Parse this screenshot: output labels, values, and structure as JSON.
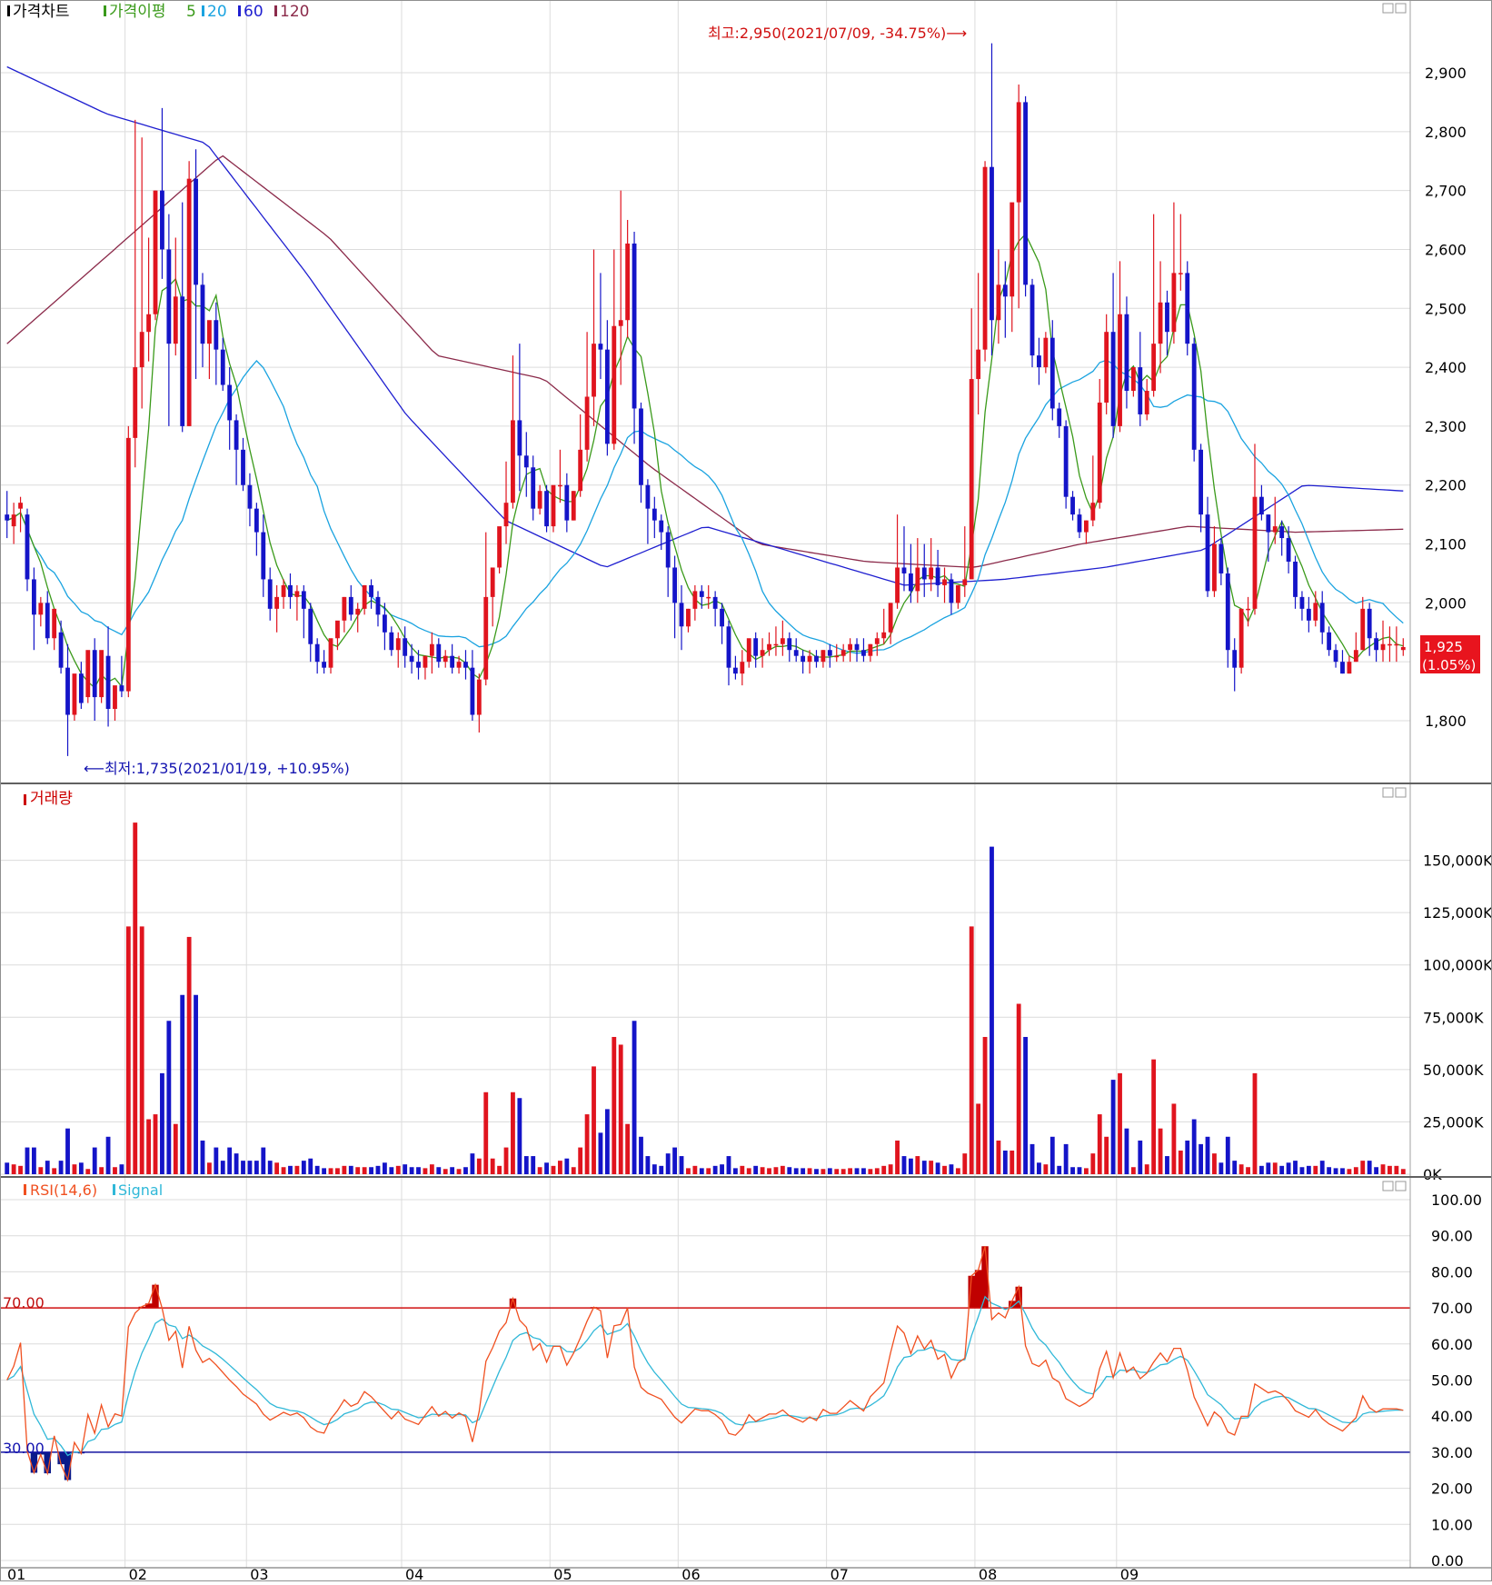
{
  "price_panel": {
    "legend": [
      {
        "label": "가격차트",
        "color": "#000000"
      },
      {
        "label": "가격이평",
        "color": "#3a9a1a"
      },
      {
        "label": "5",
        "color": "#3a9a1a"
      },
      {
        "label": "20",
        "color": "#1aa3e0"
      },
      {
        "label": "60",
        "color": "#1f1fd0"
      },
      {
        "label": "120",
        "color": "#8b2a4a"
      }
    ],
    "high_annotation": "최고:2,950(2021/07/09, -34.75%)⟶",
    "low_annotation": "⟵최저:1,735(2021/01/19, +10.95%)",
    "y_ticks": [
      "2,900",
      "2,800",
      "2,700",
      "2,600",
      "2,500",
      "2,400",
      "2,300",
      "2,200",
      "2,100",
      "2,000",
      "1,800"
    ],
    "current_price": "1,925",
    "current_change": "(1.05%)"
  },
  "volume_panel": {
    "legend": [
      {
        "label": "거래량",
        "color": "#cc0000"
      }
    ],
    "y_ticks": [
      "150,000K",
      "125,000K",
      "100,000K",
      "75,000K",
      "50,000K",
      "25,000K",
      "0K"
    ]
  },
  "rsi_panel": {
    "legend": [
      {
        "label": "RSI(14,6)",
        "color": "#f05020"
      },
      {
        "label": "Signal",
        "color": "#30b8d8"
      }
    ],
    "y_ticks": [
      "100.00",
      "90.00",
      "80.00",
      "70.00",
      "60.00",
      "50.00",
      "40.00",
      "30.00",
      "20.00",
      "10.00",
      "0.00"
    ],
    "upper_line_label": "70.00",
    "lower_line_label": "30.00"
  },
  "x_labels": [
    "01",
    "02",
    "03",
    "04",
    "05",
    "06",
    "07",
    "08",
    "09"
  ],
  "colors": {
    "up": "#e0141e",
    "down": "#1414c8",
    "ma5": "#3a9a1a",
    "ma20": "#1aa3e0",
    "ma60": "#1f1fd0",
    "ma120": "#8b2a4a",
    "rsi": "#f05020",
    "signal": "#30b8d8",
    "grid": "#dcdcdc"
  },
  "chart_data": {
    "type": "candlestick",
    "ylim": [
      1700,
      2990
    ],
    "volume_ylim": [
      0,
      175000
    ],
    "rsi_ylim": [
      0,
      100
    ],
    "months": [
      "01",
      "02",
      "03",
      "04",
      "05",
      "06",
      "07",
      "08",
      "09"
    ],
    "high": {
      "value": 2950,
      "date": "2021/07/09",
      "change": "-34.75%"
    },
    "low": {
      "value": 1735,
      "date": "2021/01/19",
      "change": "+10.95%"
    },
    "last_close": 1925,
    "last_change_pct": 1.05,
    "rsi_levels": [
      70,
      30
    ],
    "months_candles": [
      {
        "month": "01",
        "days": 18
      },
      {
        "month": "02",
        "days": 18
      },
      {
        "month": "03",
        "days": 23
      },
      {
        "month": "04",
        "days": 22
      },
      {
        "month": "05",
        "days": 19
      },
      {
        "month": "06",
        "days": 22
      },
      {
        "month": "07",
        "days": 22
      },
      {
        "month": "08",
        "days": 21
      },
      {
        "month": "09",
        "days": 16
      }
    ],
    "candles": [
      [
        2150,
        2190,
        2140,
        2110
      ],
      [
        2130,
        2170,
        2150,
        2100
      ],
      [
        2160,
        2180,
        2170,
        2120
      ],
      [
        2150,
        2160,
        2040,
        2020
      ],
      [
        2040,
        2060,
        1980,
        1920
      ],
      [
        1980,
        2010,
        2000,
        1960
      ],
      [
        2000,
        2020,
        1940,
        1930
      ],
      [
        1940,
        1960,
        1990,
        1920
      ],
      [
        1950,
        1970,
        1890,
        1880
      ],
      [
        1890,
        1930,
        1810,
        1740
      ],
      [
        1810,
        1870,
        1880,
        1800
      ],
      [
        1880,
        1900,
        1830,
        1820
      ],
      [
        1840,
        1860,
        1920,
        1830
      ],
      [
        1920,
        1940,
        1840,
        1800
      ],
      [
        1840,
        1880,
        1920,
        1830
      ],
      [
        1910,
        1960,
        1820,
        1790
      ],
      [
        1820,
        1850,
        1860,
        1800
      ],
      [
        1860,
        1910,
        1850,
        1840
      ],
      [
        1850,
        2300,
        2280,
        1840
      ],
      [
        2280,
        2820,
        2400,
        2230
      ],
      [
        2400,
        2790,
        2460,
        2330
      ],
      [
        2460,
        2620,
        2490,
        2410
      ],
      [
        2490,
        2700,
        2700,
        2480
      ],
      [
        2700,
        2840,
        2600,
        2550
      ],
      [
        2600,
        2660,
        2440,
        2300
      ],
      [
        2440,
        2620,
        2520,
        2420
      ],
      [
        2520,
        2680,
        2300,
        2290
      ],
      [
        2300,
        2750,
        2720,
        2300
      ],
      [
        2720,
        2770,
        2540,
        2380
      ],
      [
        2540,
        2560,
        2440,
        2400
      ],
      [
        2440,
        2460,
        2480,
        2380
      ],
      [
        2480,
        2510,
        2430,
        2370
      ],
      [
        2430,
        2450,
        2370,
        2360
      ],
      [
        2370,
        2400,
        2310,
        2260
      ],
      [
        2310,
        2320,
        2260,
        2200
      ],
      [
        2260,
        2280,
        2200,
        2190
      ],
      [
        2200,
        2220,
        2160,
        2130
      ],
      [
        2160,
        2170,
        2120,
        2080
      ],
      [
        2120,
        2150,
        2040,
        2010
      ],
      [
        2040,
        2060,
        1990,
        1970
      ],
      [
        1990,
        2030,
        2010,
        1950
      ],
      [
        2010,
        2040,
        2030,
        1990
      ],
      [
        2030,
        2050,
        2010,
        1990
      ],
      [
        2010,
        2030,
        2020,
        1970
      ],
      [
        2020,
        2030,
        1990,
        1940
      ],
      [
        1990,
        2000,
        1930,
        1900
      ],
      [
        1930,
        1940,
        1900,
        1880
      ],
      [
        1900,
        1920,
        1890,
        1880
      ],
      [
        1890,
        1920,
        1940,
        1880
      ],
      [
        1940,
        1960,
        1970,
        1920
      ],
      [
        1970,
        2010,
        2010,
        1950
      ],
      [
        2010,
        2030,
        1980,
        1970
      ],
      [
        1980,
        2000,
        1990,
        1950
      ],
      [
        1990,
        2030,
        2030,
        1980
      ],
      [
        2030,
        2040,
        2010,
        1990
      ],
      [
        2010,
        2020,
        1980,
        1960
      ],
      [
        1980,
        2000,
        1950,
        1920
      ],
      [
        1950,
        1960,
        1920,
        1910
      ],
      [
        1920,
        1950,
        1940,
        1890
      ],
      [
        1940,
        1960,
        1910,
        1890
      ],
      [
        1910,
        1930,
        1900,
        1880
      ],
      [
        1900,
        1920,
        1890,
        1870
      ],
      [
        1890,
        1910,
        1910,
        1870
      ],
      [
        1910,
        1950,
        1930,
        1880
      ],
      [
        1930,
        1940,
        1900,
        1890
      ],
      [
        1900,
        1920,
        1910,
        1890
      ],
      [
        1910,
        1930,
        1890,
        1880
      ],
      [
        1890,
        1910,
        1900,
        1880
      ],
      [
        1900,
        1920,
        1890,
        1870
      ],
      [
        1890,
        1920,
        1810,
        1800
      ],
      [
        1810,
        1880,
        1870,
        1780
      ],
      [
        1870,
        2120,
        2010,
        1860
      ],
      [
        2010,
        2060,
        2060,
        1960
      ],
      [
        2060,
        2110,
        2130,
        2050
      ],
      [
        2130,
        2240,
        2170,
        2100
      ],
      [
        2170,
        2420,
        2310,
        2160
      ],
      [
        2310,
        2440,
        2250,
        2190
      ],
      [
        2250,
        2290,
        2230,
        2180
      ],
      [
        2230,
        2250,
        2160,
        2140
      ],
      [
        2160,
        2200,
        2190,
        2150
      ],
      [
        2190,
        2200,
        2130,
        2120
      ],
      [
        2130,
        2180,
        2200,
        2120
      ],
      [
        2200,
        2260,
        2200,
        2170
      ],
      [
        2200,
        2220,
        2140,
        2120
      ],
      [
        2140,
        2190,
        2190,
        2140
      ],
      [
        2190,
        2320,
        2260,
        2180
      ],
      [
        2260,
        2460,
        2350,
        2240
      ],
      [
        2350,
        2600,
        2440,
        2300
      ],
      [
        2440,
        2560,
        2430,
        2380
      ],
      [
        2430,
        2480,
        2270,
        2250
      ],
      [
        2270,
        2600,
        2470,
        2260
      ],
      [
        2470,
        2700,
        2480,
        2370
      ],
      [
        2480,
        2650,
        2610,
        2450
      ],
      [
        2610,
        2630,
        2330,
        2270
      ],
      [
        2330,
        2340,
        2200,
        2170
      ],
      [
        2200,
        2210,
        2160,
        2100
      ],
      [
        2160,
        2180,
        2140,
        2110
      ],
      [
        2140,
        2150,
        2120,
        2090
      ],
      [
        2120,
        2130,
        2060,
        2010
      ],
      [
        2060,
        2080,
        2000,
        1940
      ],
      [
        2000,
        2030,
        1960,
        1920
      ],
      [
        1960,
        1990,
        1990,
        1950
      ],
      [
        1990,
        2030,
        2020,
        1970
      ],
      [
        2020,
        2030,
        2010,
        1990
      ],
      [
        2010,
        2030,
        2010,
        1990
      ],
      [
        2010,
        2020,
        1990,
        1960
      ],
      [
        1990,
        2000,
        1960,
        1930
      ],
      [
        1960,
        1970,
        1890,
        1860
      ],
      [
        1890,
        1910,
        1880,
        1870
      ],
      [
        1880,
        1920,
        1900,
        1860
      ],
      [
        1900,
        1930,
        1940,
        1890
      ],
      [
        1940,
        1950,
        1910,
        1890
      ],
      [
        1910,
        1940,
        1920,
        1890
      ],
      [
        1920,
        1950,
        1930,
        1910
      ],
      [
        1930,
        1960,
        1930,
        1910
      ],
      [
        1930,
        1970,
        1940,
        1910
      ],
      [
        1940,
        1950,
        1920,
        1900
      ],
      [
        1920,
        1940,
        1910,
        1900
      ],
      [
        1910,
        1920,
        1900,
        1880
      ],
      [
        1900,
        1920,
        1910,
        1880
      ],
      [
        1910,
        1920,
        1900,
        1890
      ],
      [
        1900,
        1920,
        1920,
        1890
      ],
      [
        1920,
        1930,
        1910,
        1890
      ],
      [
        1910,
        1930,
        1910,
        1900
      ],
      [
        1910,
        1930,
        1920,
        1900
      ],
      [
        1920,
        1940,
        1930,
        1900
      ],
      [
        1930,
        1940,
        1920,
        1900
      ],
      [
        1920,
        1940,
        1910,
        1900
      ],
      [
        1910,
        1930,
        1930,
        1900
      ],
      [
        1930,
        1950,
        1940,
        1910
      ],
      [
        1940,
        1990,
        1950,
        1930
      ],
      [
        1950,
        2000,
        2000,
        1930
      ],
      [
        2000,
        2150,
        2060,
        1990
      ],
      [
        2060,
        2130,
        2050,
        2020
      ],
      [
        2050,
        2100,
        2020,
        2000
      ],
      [
        2020,
        2110,
        2060,
        2000
      ],
      [
        2060,
        2100,
        2040,
        2010
      ],
      [
        2040,
        2110,
        2060,
        2020
      ],
      [
        2060,
        2090,
        2030,
        2010
      ],
      [
        2030,
        2060,
        2040,
        2000
      ],
      [
        2040,
        2050,
        2000,
        1980
      ],
      [
        2000,
        2030,
        2030,
        1990
      ],
      [
        2030,
        2130,
        2040,
        2010
      ],
      [
        2040,
        2500,
        2380,
        2040
      ],
      [
        2380,
        2560,
        2430,
        2320
      ],
      [
        2430,
        2750,
        2740,
        2410
      ],
      [
        2740,
        2950,
        2480,
        2420
      ],
      [
        2480,
        2600,
        2540,
        2440
      ],
      [
        2540,
        2580,
        2520,
        2450
      ],
      [
        2520,
        2590,
        2680,
        2460
      ],
      [
        2680,
        2880,
        2850,
        2500
      ],
      [
        2850,
        2860,
        2540,
        2520
      ],
      [
        2540,
        2550,
        2420,
        2400
      ],
      [
        2420,
        2450,
        2400,
        2370
      ],
      [
        2400,
        2460,
        2450,
        2390
      ],
      [
        2450,
        2480,
        2330,
        2310
      ],
      [
        2330,
        2340,
        2300,
        2280
      ],
      [
        2300,
        2310,
        2180,
        2160
      ],
      [
        2180,
        2190,
        2150,
        2140
      ],
      [
        2150,
        2160,
        2120,
        2110
      ],
      [
        2120,
        2140,
        2140,
        2100
      ],
      [
        2140,
        2250,
        2170,
        2130
      ],
      [
        2170,
        2380,
        2340,
        2160
      ],
      [
        2340,
        2490,
        2460,
        2320
      ],
      [
        2460,
        2560,
        2300,
        2280
      ],
      [
        2300,
        2580,
        2490,
        2290
      ],
      [
        2490,
        2520,
        2360,
        2330
      ],
      [
        2360,
        2400,
        2400,
        2350
      ],
      [
        2400,
        2460,
        2320,
        2300
      ],
      [
        2320,
        2380,
        2360,
        2310
      ],
      [
        2360,
        2660,
        2440,
        2350
      ],
      [
        2440,
        2580,
        2510,
        2390
      ],
      [
        2510,
        2530,
        2460,
        2420
      ],
      [
        2460,
        2680,
        2560,
        2440
      ],
      [
        2560,
        2660,
        2560,
        2530
      ],
      [
        2560,
        2580,
        2440,
        2420
      ],
      [
        2440,
        2450,
        2260,
        2240
      ],
      [
        2260,
        2270,
        2150,
        2120
      ],
      [
        2150,
        2180,
        2020,
        2010
      ],
      [
        2020,
        2130,
        2100,
        2010
      ],
      [
        2100,
        2110,
        2050,
        2030
      ],
      [
        2050,
        2060,
        1920,
        1890
      ],
      [
        1920,
        1940,
        1890,
        1850
      ],
      [
        1890,
        1950,
        1990,
        1880
      ],
      [
        1990,
        2010,
        1990,
        1960
      ],
      [
        1990,
        2270,
        2180,
        1980
      ],
      [
        2180,
        2200,
        2150,
        2140
      ],
      [
        2150,
        2150,
        2120,
        2070
      ],
      [
        2120,
        2180,
        2130,
        2100
      ],
      [
        2130,
        2140,
        2110,
        2080
      ],
      [
        2110,
        2130,
        2070,
        2050
      ],
      [
        2070,
        2080,
        2010,
        1990
      ],
      [
        2010,
        2020,
        1990,
        1970
      ],
      [
        1990,
        2010,
        1970,
        1950
      ],
      [
        1970,
        2020,
        2000,
        1960
      ],
      [
        2000,
        2020,
        1950,
        1930
      ],
      [
        1950,
        1960,
        1920,
        1910
      ],
      [
        1920,
        1930,
        1900,
        1890
      ],
      [
        1900,
        1920,
        1880,
        1880
      ],
      [
        1880,
        1910,
        1900,
        1880
      ],
      [
        1900,
        1950,
        1920,
        1900
      ],
      [
        1920,
        2010,
        1990,
        1920
      ],
      [
        1990,
        2000,
        1940,
        1910
      ],
      [
        1940,
        1950,
        1920,
        1900
      ],
      [
        1920,
        1970,
        1930,
        1900
      ],
      [
        1930,
        1960,
        1930,
        1900
      ],
      [
        1930,
        1960,
        1930,
        1900
      ],
      [
        1920,
        1940,
        1925,
        1910
      ]
    ]
  }
}
